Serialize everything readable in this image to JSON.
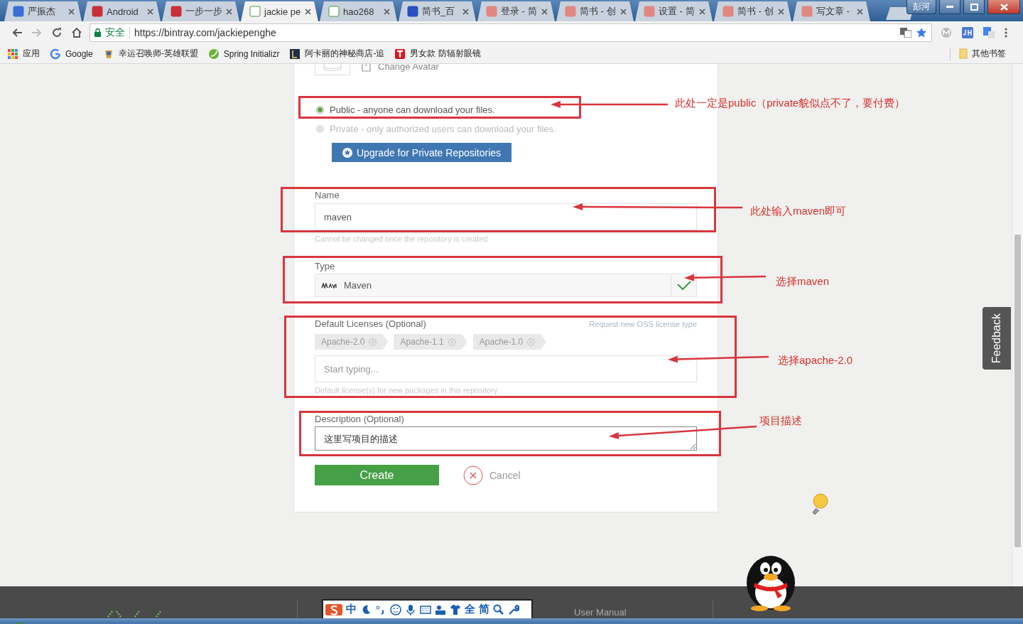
{
  "browser": {
    "tabs": [
      {
        "title": "严振杰",
        "selected": false
      },
      {
        "title": "Android",
        "selected": false
      },
      {
        "title": "一步一步",
        "selected": false
      },
      {
        "title": "jackie pe",
        "selected": true
      },
      {
        "title": "hao268",
        "selected": false
      },
      {
        "title": "简书_百",
        "selected": false
      },
      {
        "title": "登录 - 简",
        "selected": false
      },
      {
        "title": "简书 - 创",
        "selected": false
      },
      {
        "title": "设置 - 简",
        "selected": false
      },
      {
        "title": "简书 - 创",
        "selected": false
      },
      {
        "title": "写文章 -",
        "selected": false
      }
    ],
    "profile": "彭河",
    "security_label": "安全",
    "url": "https://bintray.com/jackiepenghe",
    "bookmarks": [
      {
        "label": "应用"
      },
      {
        "label": "Google"
      },
      {
        "label": "幸运召唤师-英雄联盟"
      },
      {
        "label": "Spring Initializr"
      },
      {
        "label": "阿卡丽的神秘商店-追"
      },
      {
        "label": "男女款 防辐射眼镜"
      }
    ],
    "other_bookmarks": "其他书签"
  },
  "form": {
    "avatar_action": "Change Avatar",
    "visibility": [
      {
        "label": "Public - anyone can download your files.",
        "selected": true,
        "disabled": false
      },
      {
        "label": "Private - only authorized users can download your files.",
        "selected": false,
        "disabled": true
      }
    ],
    "upgrade_button": "Upgrade for Private Repositories",
    "name": {
      "label": "Name",
      "value": "maven",
      "hint": "Cannot be changed once the repository is created"
    },
    "type": {
      "label": "Type",
      "value": "Maven",
      "valid": true
    },
    "licenses": {
      "label": "Default Licenses (Optional)",
      "request_link": "Request new OSS license type",
      "tags": [
        "Apache-2.0",
        "Apache-1.1",
        "Apache-1.0"
      ],
      "placeholder": "Start typing...",
      "hint": "Default license(s) for new packages in this repository"
    },
    "description": {
      "label": "Description (Optional)",
      "value": "这里写项目的描述"
    },
    "create_button": "Create",
    "cancel_button": "Cancel"
  },
  "annotations": [
    {
      "note": "此处一定是public（private貌似点不了，要付费）"
    },
    {
      "note": "此处输入maven即可"
    },
    {
      "note": "选择maven"
    },
    {
      "note": "选择apache-2.0"
    },
    {
      "note": "项目描述"
    }
  ],
  "feedback": "Feedback",
  "footer": {
    "link": "User Manual"
  },
  "ime": {
    "mode": "中",
    "width_mode": "全",
    "script": "简"
  }
}
